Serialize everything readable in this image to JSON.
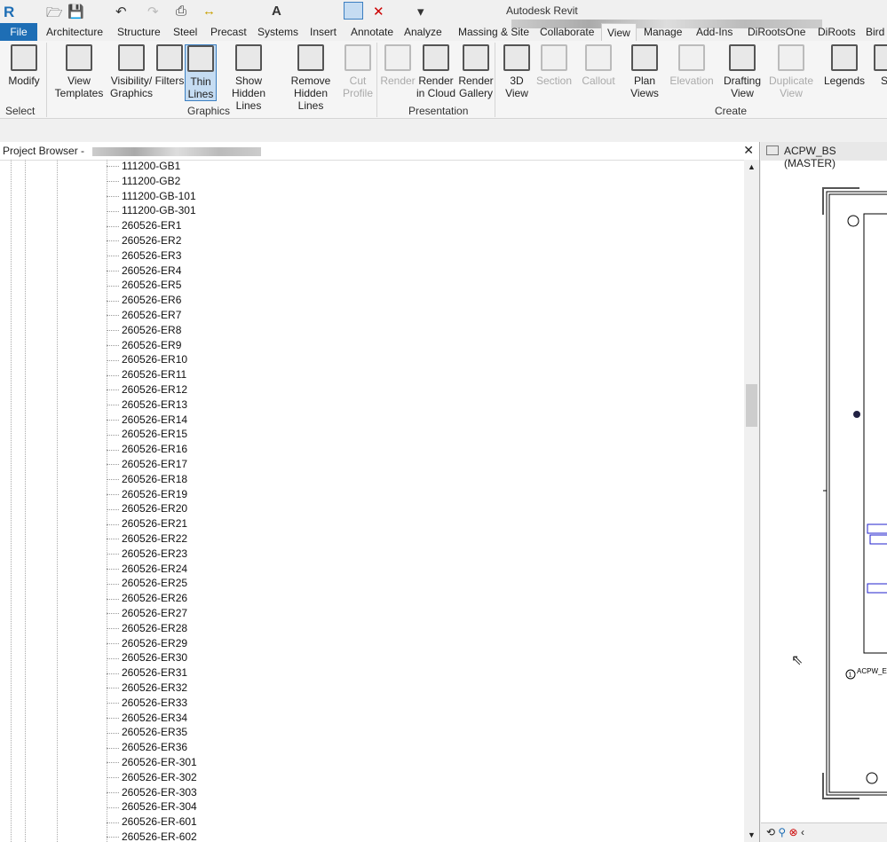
{
  "app": {
    "title": "Autodesk Revit"
  },
  "tabs": [
    "File",
    "Architecture",
    "Structure",
    "Steel",
    "Precast",
    "Systems",
    "Insert",
    "Annotate",
    "Analyze",
    "Massing & Site",
    "Collaborate",
    "View",
    "Manage",
    "Add-Ins",
    "DiRootsOne",
    "DiRoots",
    "Bird"
  ],
  "active_tab": "View",
  "ribbon": {
    "buttons": [
      {
        "label": "Modify",
        "state": "normal"
      },
      {
        "label": "View Templates",
        "state": "normal"
      },
      {
        "label": "Visibility/ Graphics",
        "state": "normal"
      },
      {
        "label": "Filters",
        "state": "normal"
      },
      {
        "label": "Thin Lines",
        "state": "selected"
      },
      {
        "label": "Show Hidden Lines",
        "state": "normal"
      },
      {
        "label": "Remove Hidden Lines",
        "state": "normal"
      },
      {
        "label": "Cut Profile",
        "state": "disabled"
      },
      {
        "label": "Render",
        "state": "disabled"
      },
      {
        "label": "Render in Cloud",
        "state": "normal"
      },
      {
        "label": "Render Gallery",
        "state": "normal"
      },
      {
        "label": "3D View",
        "state": "normal"
      },
      {
        "label": "Section",
        "state": "disabled"
      },
      {
        "label": "Callout",
        "state": "disabled"
      },
      {
        "label": "Plan Views",
        "state": "normal"
      },
      {
        "label": "Elevation",
        "state": "disabled"
      },
      {
        "label": "Drafting View",
        "state": "normal"
      },
      {
        "label": "Duplicate View",
        "state": "disabled"
      },
      {
        "label": "Legends",
        "state": "normal"
      },
      {
        "label": "Sc",
        "state": "normal"
      }
    ],
    "panels": [
      "Select",
      "Graphics",
      "Presentation",
      "Create"
    ]
  },
  "project_browser": {
    "title": "Project Browser -",
    "items": [
      "111200-GB1",
      "111200-GB2",
      "111200-GB-101",
      "111200-GB-301",
      "260526-ER1",
      "260526-ER2",
      "260526-ER3",
      "260526-ER4",
      "260526-ER5",
      "260526-ER6",
      "260526-ER7",
      "260526-ER8",
      "260526-ER9",
      "260526-ER10",
      "260526-ER11",
      "260526-ER12",
      "260526-ER13",
      "260526-ER14",
      "260526-ER15",
      "260526-ER16",
      "260526-ER17",
      "260526-ER18",
      "260526-ER19",
      "260526-ER20",
      "260526-ER21",
      "260526-ER22",
      "260526-ER23",
      "260526-ER24",
      "260526-ER25",
      "260526-ER26",
      "260526-ER27",
      "260526-ER28",
      "260526-ER29",
      "260526-ER30",
      "260526-ER31",
      "260526-ER32",
      "260526-ER33",
      "260526-ER34",
      "260526-ER35",
      "260526-ER36",
      "260526-ER-301",
      "260526-ER-302",
      "260526-ER-303",
      "260526-ER-304",
      "260526-ER-601",
      "260526-ER-602"
    ]
  },
  "view": {
    "title": "ACPW_BS (MASTER)",
    "tag": "ACPW_E",
    "tag_num": "1"
  },
  "colors": {
    "file_tab": "#1e6eb5",
    "selected": "#c5dcf2"
  }
}
